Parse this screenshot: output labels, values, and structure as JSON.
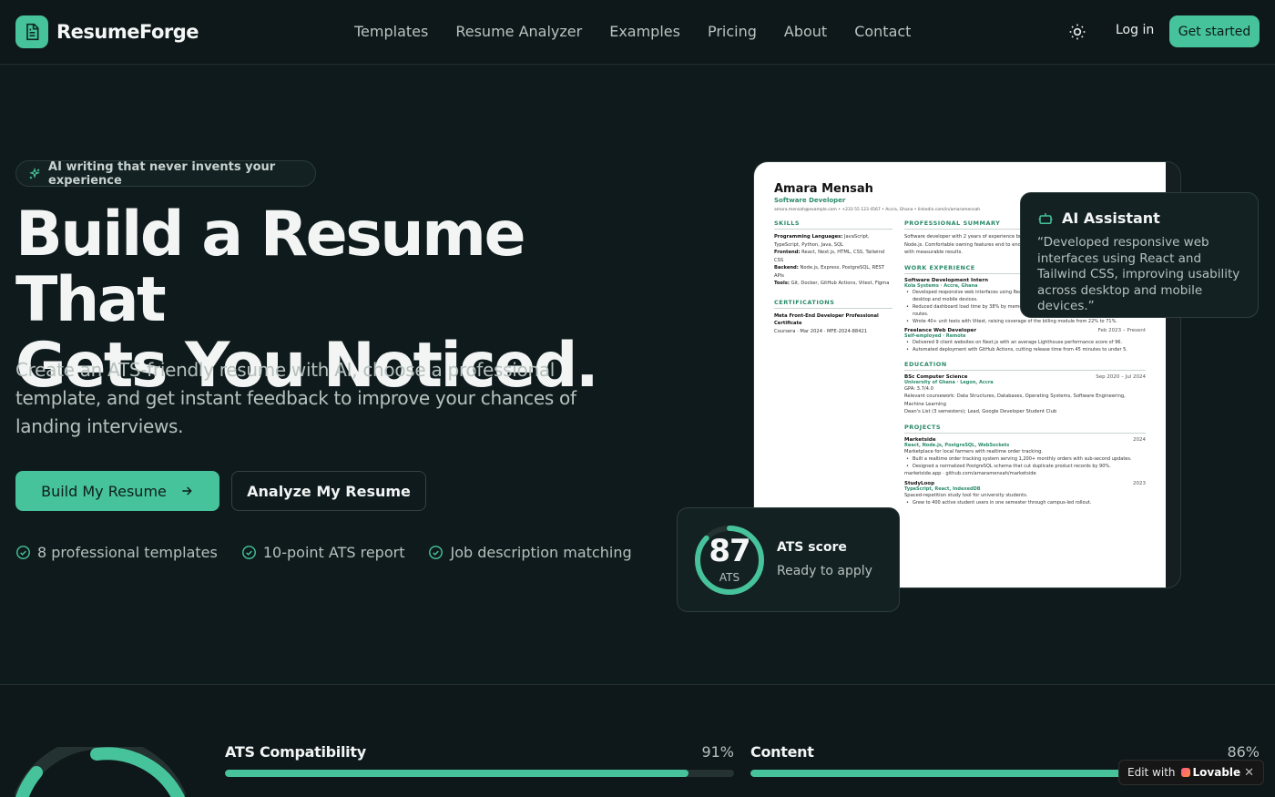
{
  "nav": {
    "brand": "ResumeForge",
    "links": [
      "Templates",
      "Resume Analyzer",
      "Examples",
      "Pricing",
      "About",
      "Contact"
    ],
    "login": "Log in",
    "cta": "Get started"
  },
  "hero": {
    "pill": "AI writing that never invents your experience",
    "headline_line1": "Build a Resume That",
    "headline_line2": "Gets You Noticed.",
    "subhead": "Create an ATS-friendly resume with AI, choose a professional template, and get instant feedback to improve your chances of landing interviews.",
    "primary_cta": "Build My Resume",
    "secondary_cta": "Analyze My Resume",
    "features": [
      "8 professional templates",
      "10-point ATS report",
      "Job description matching"
    ]
  },
  "resume": {
    "name": "Amara Mensah",
    "role": "Software Developer",
    "contact": "amara.mensah@example.com • +233 55 123 4567 • Accra, Ghana • linkedin.com/in/amaramensah",
    "skills_title": "SKILLS",
    "skills": [
      {
        "k": "Programming Languages:",
        "v": "JavaScript, TypeScript, Python, Java, SQL"
      },
      {
        "k": "Frontend:",
        "v": "React, Next.js, HTML, CSS, Tailwind CSS"
      },
      {
        "k": "Backend:",
        "v": "Node.js, Express, PostgreSQL, REST APIs"
      },
      {
        "k": "Tools:",
        "v": "Git, Docker, GitHub Actions, Vitest, Figma"
      }
    ],
    "cert_title": "CERTIFICATIONS",
    "cert_name": "Meta Front-End Developer Professional Certificate",
    "cert_meta": "Coursera · Mar 2024 · MFE-2024-88421",
    "summary_title": "PROFESSIONAL SUMMARY",
    "summary": "Software developer with 2 years of experience building web applications with React, TypeScript and Node.js. Comfortable owning features end to end, shipping accessible UI, and improving performance with measurable results.",
    "work_title": "WORK EXPERIENCE",
    "job1_title": "Software Development Intern",
    "job1_co": "Kola Systems · Accra, Ghana",
    "job1_bullets": [
      "Developed responsive web interfaces using React and Tailwind CSS, improving usability across desktop and mobile devices.",
      "Reduced dashboard load time by 38% by memoizing expensive chart computations and lazy-loading routes.",
      "Wrote 40+ unit tests with Vitest, raising coverage of the billing module from 22% to 71%."
    ],
    "job2_title": "Freelance Web Developer",
    "job2_date": "Feb 2023 – Present",
    "job2_co": "Self-employed · Remote",
    "job2_bullets": [
      "Delivered 9 client websites on Next.js with an average Lighthouse performance score of 96.",
      "Automated deployment with GitHub Actions, cutting release time from 45 minutes to under 5."
    ],
    "edu_title": "EDUCATION",
    "edu_degree": "BSc Computer Science",
    "edu_date": "Sep 2020 – Jul 2024",
    "edu_school": "University of Ghana · Legon, Accra",
    "edu_gpa": "GPA: 3.7/4.0",
    "edu_details": "Relevant coursework: Data Structures, Databases, Operating Systems, Software Engineering, Machine Learning",
    "edu_honors": "Dean's List (3 semesters); Lead, Google Developer Student Club",
    "proj_title": "PROJECTS",
    "proj1_name": "Marketside",
    "proj1_year": "2024",
    "proj1_stack": "React, Node.js, PostgreSQL, WebSockets",
    "proj1_desc": "Marketplace for local farmers with realtime order tracking.",
    "proj1_bullets": [
      "Built a realtime order tracking system serving 1,200+ monthly orders with sub-second updates.",
      "Designed a normalized PostgreSQL schema that cut duplicate product records by 90%."
    ],
    "proj1_link": "marketside.app · github.com/amaramensah/marketside",
    "proj2_name": "StudyLoop",
    "proj2_year": "2023",
    "proj2_stack": "TypeScript, React, IndexedDB",
    "proj2_desc": "Spaced-repetition study tool for university students.",
    "proj2_bullets": [
      "Grew to 400 active student users in one semester through campus-led rollout."
    ]
  },
  "ai_card": {
    "title": "AI Assistant",
    "quote": "“Developed responsive web interfaces using React and Tailwind CSS, improving usability across desktop and mobile devices.”"
  },
  "ats_card": {
    "score": "87",
    "score_fraction": 0.87,
    "label": "ATS",
    "title": "ATS score",
    "subtitle": "Ready to apply"
  },
  "metrics": [
    {
      "label": "ATS Compatibility",
      "value": "91%",
      "fraction": 0.91
    },
    {
      "label": "Content",
      "value": "86%",
      "fraction": 0.86
    }
  ],
  "lovable": {
    "edit": "Edit with",
    "brand": "Lovable",
    "close": "✕"
  },
  "colors": {
    "accent": "#46c39a",
    "background": "#0f1a1c",
    "card": "#142123"
  }
}
